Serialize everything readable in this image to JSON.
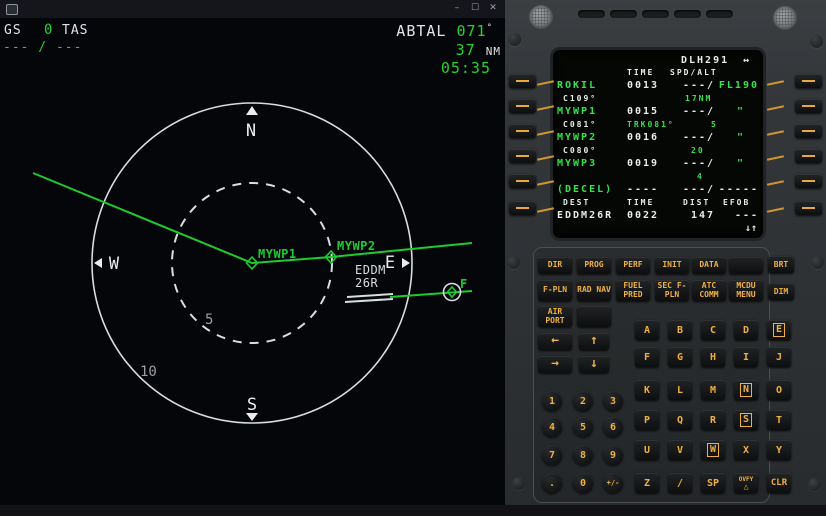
{
  "window": {
    "controls": {
      "min": "–",
      "max": "☐",
      "close": "✕"
    }
  },
  "nd": {
    "gs_label": "GS",
    "gs_value": "0",
    "tas_label": "TAS",
    "speed_readout": "--- / ---",
    "next_wpt": {
      "ident": "ABTAL",
      "bearing": "071",
      "degree": "°",
      "distance": "37",
      "unit": "NM",
      "eta": "05:35"
    },
    "compass": {
      "n": "N",
      "s": "S",
      "e": "E",
      "w": "W"
    },
    "ranges": {
      "half": "5",
      "full": "10"
    },
    "labels": {
      "wp1": "MYWP1",
      "wp2": "MYWP2",
      "fix": "F",
      "apt": "EDDM",
      "rwy": "26R"
    },
    "colors": {
      "path_green": "#1ecb2e",
      "line_white": "#d8dde0"
    }
  },
  "mcdu": {
    "screen": {
      "title": "DLH291",
      "lat_rev_arrows": "↔",
      "col_time": "TIME",
      "col_spdalt": "SPD/ALT",
      "rows": [
        {
          "ident": "ROKIL",
          "time": "0013",
          "spd": "---/",
          "alt": "FL190"
        },
        {
          "ident": "MYWP1",
          "time": "0015",
          "spd": "---/",
          "alt": "\""
        },
        {
          "ident": "MYWP2",
          "time": "0016",
          "spd": "---/",
          "alt": "\""
        },
        {
          "ident": "MYWP3",
          "time": "0019",
          "spd": "---/",
          "alt": "\""
        },
        {
          "ident": "(DECEL)",
          "time": "----",
          "spd": "---/",
          "alt": "-----"
        }
      ],
      "labels": [
        {
          "course": "C109°",
          "track": "",
          "dist": "17NM"
        },
        {
          "course": "C081°",
          "track": "TRK081°",
          "dist": "5"
        },
        {
          "course": "C080°",
          "track": "",
          "dist": "20"
        },
        {
          "course": "",
          "track": "",
          "dist": "4"
        }
      ],
      "dest_header": {
        "dest": "DEST",
        "time": "TIME",
        "dist": "DIST",
        "efob": "EFOB"
      },
      "dest_row": {
        "ident": "EDDM26R",
        "time": "0022",
        "dist": "147",
        "efob": "---"
      },
      "vert_arrows": "↓↑"
    },
    "keys": {
      "function_row1": [
        "DIR",
        "PROG",
        "PERF",
        "INIT",
        "DATA"
      ],
      "function_row2": [
        "F-PLN",
        "RAD NAV",
        "FUEL PRED",
        "SEC F-PLN",
        "ATC COMM",
        "MCDU MENU"
      ],
      "airport": "AIR PORT",
      "brt": "BRT",
      "dim": "DIM",
      "slew": {
        "left": "←",
        "up": "↑",
        "right": "→",
        "down": "↓"
      },
      "numpad": [
        "1",
        "2",
        "3",
        "4",
        "5",
        "6",
        "7",
        "8",
        "9",
        ".",
        "0",
        "+/-"
      ],
      "alpha": [
        "A",
        "B",
        "C",
        "D",
        "E",
        "F",
        "G",
        "H",
        "I",
        "J",
        "K",
        "L",
        "M",
        "N",
        "O",
        "P",
        "Q",
        "R",
        "S",
        "T",
        "U",
        "V",
        "W",
        "X",
        "Y"
      ],
      "bottom_row": [
        "Z",
        "/",
        "SP"
      ],
      "ovfy": "OVFY",
      "ovfy_symbol": "△",
      "clr": "CLR"
    }
  }
}
